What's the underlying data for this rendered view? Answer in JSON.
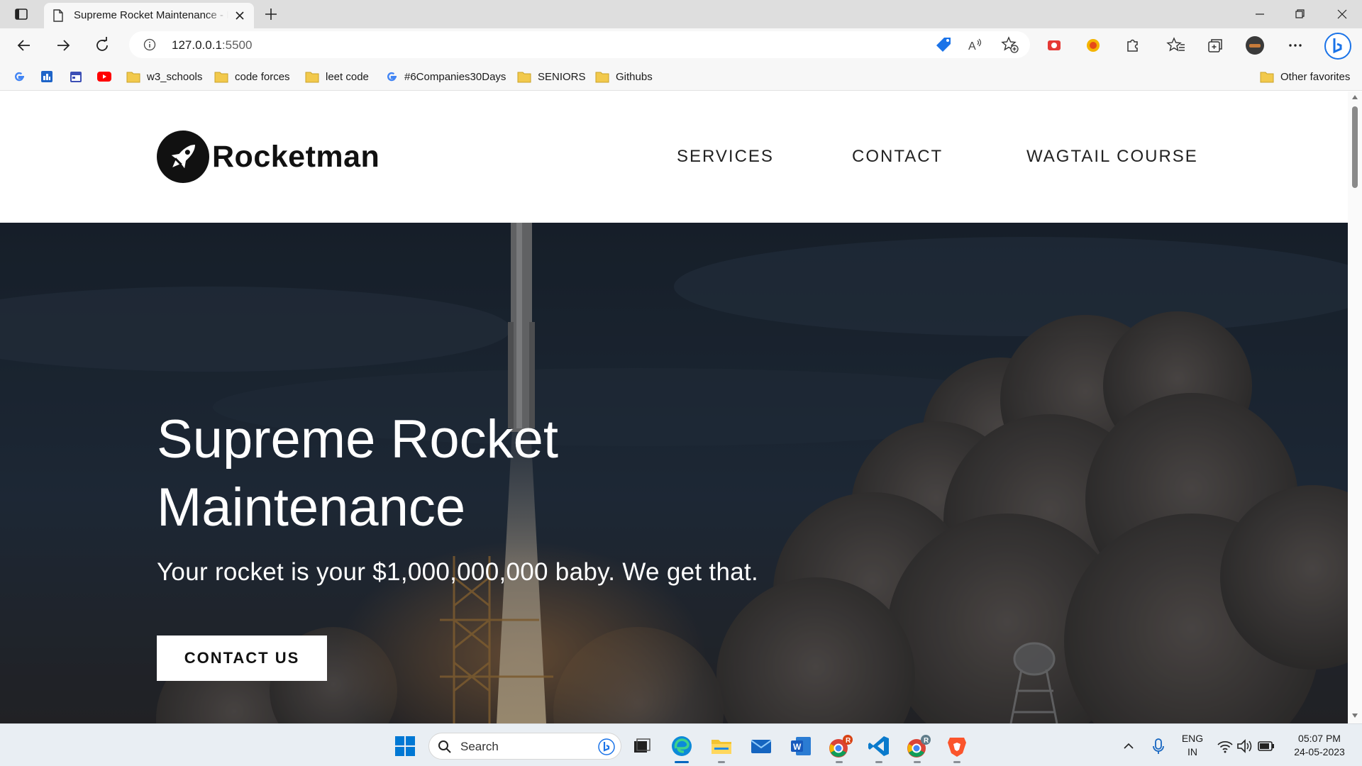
{
  "browser": {
    "tab": {
      "title": "Supreme Rocket Maintenance - F"
    },
    "address": {
      "host": "127.0.0.1",
      "port": ":5500"
    },
    "bookmarks": [
      {
        "label": "",
        "icon": "google-icon"
      },
      {
        "label": "",
        "icon": "app-icon"
      },
      {
        "label": "",
        "icon": "calendar-icon"
      },
      {
        "label": "",
        "icon": "youtube-icon"
      },
      {
        "label": "w3_schools",
        "icon": "folder-icon"
      },
      {
        "label": "code forces",
        "icon": "folder-icon"
      },
      {
        "label": "leet code",
        "icon": "folder-icon"
      },
      {
        "label": "#6Companies30Days",
        "icon": "google-icon"
      },
      {
        "label": "SENIORS",
        "icon": "folder-icon"
      },
      {
        "label": "Githubs",
        "icon": "folder-icon"
      }
    ],
    "other_favorites": "Other favorites"
  },
  "site": {
    "brand": "Rocketman",
    "nav": [
      "SERVICES",
      "CONTACT",
      "WAGTAIL COURSE"
    ],
    "hero": {
      "title": "Supreme Rocket Maintenance",
      "subtitle": "Your rocket is your $1,000,000,000 baby. We get that.",
      "cta": "CONTACT US"
    }
  },
  "taskbar": {
    "search_placeholder": "Search",
    "language": "ENG",
    "region": "IN",
    "time": "05:07 PM",
    "date": "24-05-2023"
  },
  "colors": {
    "accent": "#0067c0",
    "folder": "#f2c94c",
    "hero_overlay": "#1f2a38"
  }
}
